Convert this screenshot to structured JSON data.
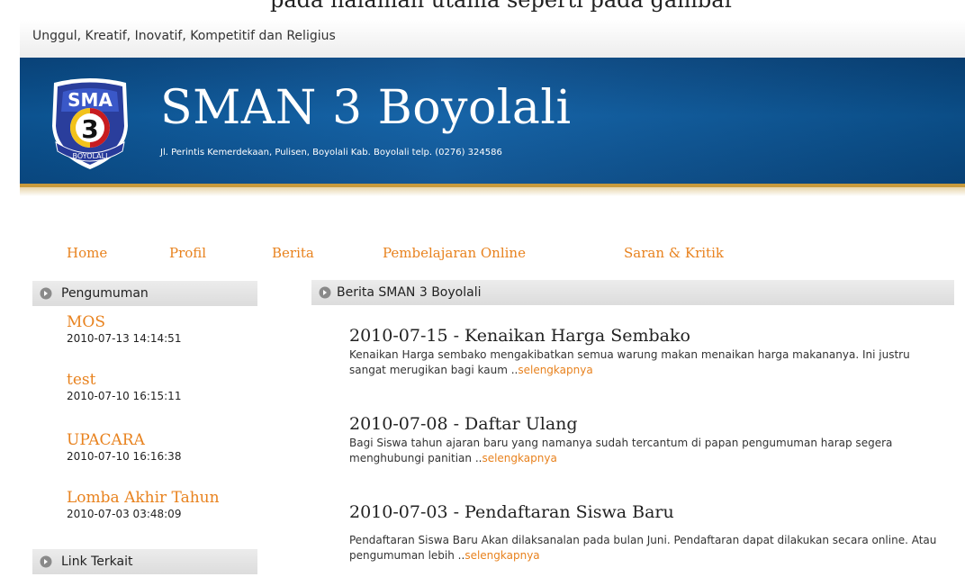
{
  "header": {
    "cutoff_text": "pada halaman utama seperti pada gambar",
    "tagline": "Unggul, Kreatif, Inovatif, Kompetitif dan Religius",
    "site_title": "SMAN 3 Boyolali",
    "address": "Jl. Perintis Kemerdekaan, Pulisen, Boyolali Kab. Boyolali telp. (0276) 324586",
    "logo": {
      "top_text": "SMA",
      "number": "3",
      "ribbon_text": "BOYOLALI"
    }
  },
  "nav": {
    "items": [
      {
        "label": "Home"
      },
      {
        "label": "Profil"
      },
      {
        "label": "Berita"
      },
      {
        "label": "Pembelajaran Online"
      },
      {
        "label": "Saran & Kritik"
      }
    ]
  },
  "sidebar": {
    "announcements_title": "Pengumuman",
    "announcements": [
      {
        "title": "MOS",
        "date": "2010-07-13 14:14:51"
      },
      {
        "title": "test",
        "date": "2010-07-10 16:15:11"
      },
      {
        "title": "UPACARA",
        "date": "2010-07-10 16:16:38"
      },
      {
        "title": "Lomba Akhir Tahun",
        "date": "2010-07-03 03:48:09"
      }
    ],
    "links_title": "Link Terkait"
  },
  "main": {
    "section_title": "Berita SMAN 3 Boyolali",
    "articles": [
      {
        "title": "2010-07-15 - Kenaikan Harga Sembako",
        "body": "Kenaikan Harga sembako mengakibatkan semua warung makan menaikan harga makananya. Ini justru sangat merugikan bagi kaum ..",
        "more": "selengkapnya"
      },
      {
        "title": "2010-07-08 - Daftar Ulang",
        "body": "Bagi Siswa tahun ajaran baru yang namanya sudah tercantum di papan pengumuman harap segera menghubungi panitian ..",
        "more": "selengkapnya"
      },
      {
        "title": "2010-07-03 - Pendaftaran Siswa Baru",
        "body": "Pendaftaran Siswa Baru Akan dilaksanalan pada bulan Juni. Pendaftaran dapat dilakukan secara online. Atau pengumuman lebih ..",
        "more": "selengkapnya"
      }
    ]
  },
  "colors": {
    "banner_blue": "#0a4f8e",
    "accent_orange": "#e8821e",
    "gold": "#c89a3c"
  }
}
